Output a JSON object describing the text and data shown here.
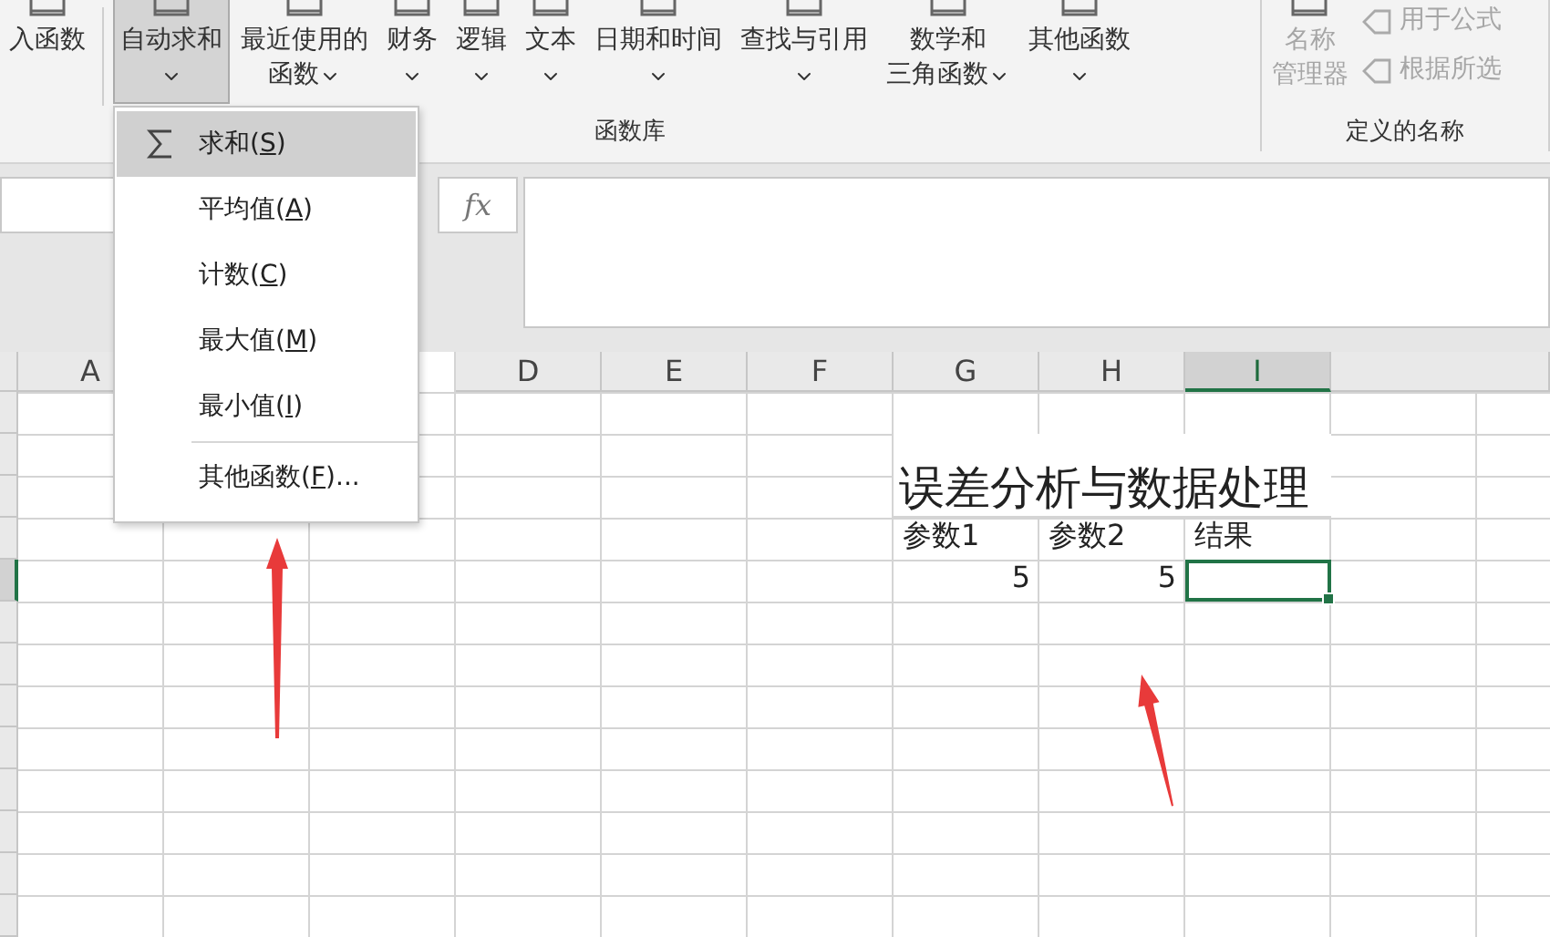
{
  "ribbon": {
    "groups": [
      {
        "label": "函数库",
        "items": [
          {
            "kind": "large",
            "lines": [
              "入函数"
            ],
            "dropdown": false,
            "pressed": false,
            "disabled": false
          },
          {
            "kind": "divider"
          },
          {
            "kind": "large",
            "lines": [
              "自动求和"
            ],
            "dropdown": true,
            "pressed": true,
            "disabled": false
          },
          {
            "kind": "large",
            "lines": [
              "最近使用的",
              "函数"
            ],
            "dropdown": true,
            "pressed": false,
            "disabled": false
          },
          {
            "kind": "large",
            "lines": [
              "财务"
            ],
            "dropdown": true,
            "pressed": false,
            "disabled": false
          },
          {
            "kind": "large",
            "lines": [
              "逻辑"
            ],
            "dropdown": true,
            "pressed": false,
            "disabled": false
          },
          {
            "kind": "large",
            "lines": [
              "文本"
            ],
            "dropdown": true,
            "pressed": false,
            "disabled": false
          },
          {
            "kind": "large",
            "lines": [
              "日期和时间"
            ],
            "dropdown": true,
            "pressed": false,
            "disabled": false
          },
          {
            "kind": "large",
            "lines": [
              "查找与引用"
            ],
            "dropdown": true,
            "pressed": false,
            "disabled": false
          },
          {
            "kind": "large",
            "lines": [
              "数学和",
              "三角函数"
            ],
            "dropdown": true,
            "pressed": false,
            "disabled": false
          },
          {
            "kind": "large",
            "lines": [
              "其他函数"
            ],
            "dropdown": true,
            "pressed": false,
            "disabled": false
          }
        ]
      },
      {
        "label": "定义的名称",
        "items": [
          {
            "kind": "large",
            "lines": [
              "名称",
              "管理器"
            ],
            "dropdown": false,
            "pressed": false,
            "disabled": true
          },
          {
            "kind": "small",
            "lines": [
              "用于公式"
            ],
            "dropdown": false,
            "pressed": false,
            "disabled": true
          },
          {
            "kind": "small",
            "lines": [
              "根据所选"
            ],
            "dropdown": false,
            "pressed": false,
            "disabled": true
          }
        ]
      }
    ]
  },
  "menu": {
    "items": [
      {
        "kind": "item",
        "before": "求和(",
        "key": "S",
        "after": ")",
        "selected": true
      },
      {
        "kind": "item",
        "before": "平均值(",
        "key": "A",
        "after": ")",
        "selected": false
      },
      {
        "kind": "item",
        "before": "计数(",
        "key": "C",
        "after": ")",
        "selected": false
      },
      {
        "kind": "item",
        "before": "最大值(",
        "key": "M",
        "after": ")",
        "selected": false
      },
      {
        "kind": "item",
        "before": "最小值(",
        "key": "I",
        "after": ")",
        "selected": false
      },
      {
        "kind": "separator"
      },
      {
        "kind": "item",
        "before": "其他函数(",
        "key": "F",
        "after": ")...",
        "selected": false
      }
    ]
  },
  "formula_bar": {
    "fx": "fx"
  },
  "sheet": {
    "columns": [
      {
        "label": "A",
        "selected": false
      },
      {},
      {},
      {
        "label": "D",
        "selected": false
      },
      {
        "label": "E",
        "selected": false
      },
      {
        "label": "F",
        "selected": false
      },
      {
        "label": "G",
        "selected": false
      },
      {
        "label": "H",
        "selected": false
      },
      {
        "label": "I",
        "selected": true
      }
    ],
    "rows": [
      {
        "cells": [
          {},
          {},
          {},
          {},
          {},
          {},
          {
            "text": "误差分析与数据处理",
            "kind": "title",
            "selected": false
          }
        ]
      },
      {
        "cells": [
          {},
          {},
          {},
          {},
          {},
          {},
          {
            "text": "参数1",
            "kind": "text",
            "selected": false
          },
          {
            "text": "参数2",
            "kind": "text",
            "selected": false
          },
          {
            "text": "结果",
            "kind": "text",
            "selected": false
          }
        ]
      },
      {
        "cells": [
          {},
          {},
          {},
          {},
          {},
          {},
          {
            "text": "5",
            "kind": "number",
            "selected": false
          },
          {
            "text": "5",
            "kind": "number",
            "selected": false
          },
          {
            "kind": "text",
            "selected": true
          }
        ]
      }
    ]
  }
}
